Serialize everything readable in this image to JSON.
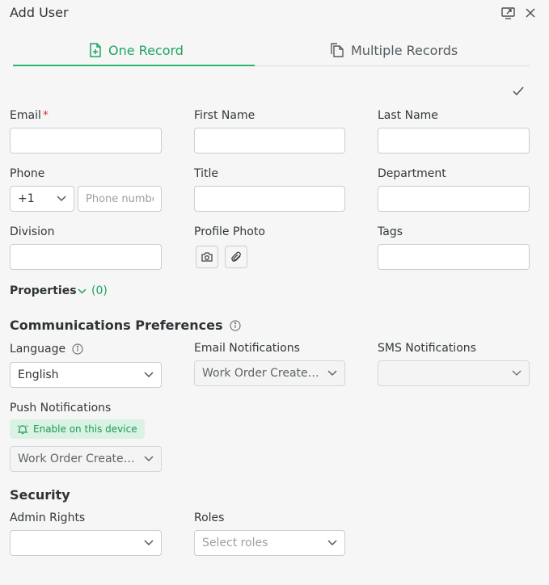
{
  "window": {
    "title": "Add User"
  },
  "tabs": [
    {
      "label": "One Record"
    },
    {
      "label": "Multiple Records"
    }
  ],
  "fields": {
    "email": {
      "label": "Email",
      "required_mark": "*",
      "value": ""
    },
    "first_name": {
      "label": "First Name",
      "value": ""
    },
    "last_name": {
      "label": "Last Name",
      "value": ""
    },
    "phone": {
      "label": "Phone",
      "country_code": "+1",
      "placeholder": "Phone number",
      "value": ""
    },
    "title": {
      "label": "Title",
      "value": ""
    },
    "department": {
      "label": "Department",
      "value": ""
    },
    "division": {
      "label": "Division",
      "value": ""
    },
    "profile_photo": {
      "label": "Profile Photo"
    },
    "tags": {
      "label": "Tags",
      "value": ""
    }
  },
  "properties": {
    "label": "Properties",
    "count": "(0)"
  },
  "communications": {
    "title": "Communications Preferences",
    "language": {
      "label": "Language",
      "value": "English"
    },
    "email_notifications": {
      "label": "Email Notifications",
      "value": "Work Order Created, Work Order Updated"
    },
    "sms_notifications": {
      "label": "SMS Notifications",
      "value": ""
    },
    "push_notifications": {
      "label": "Push Notifications",
      "enable_label": "Enable on this device",
      "value": "Work Order Created, Work Order Updated"
    }
  },
  "security": {
    "title": "Security",
    "admin_rights": {
      "label": "Admin Rights",
      "value": ""
    },
    "roles": {
      "label": "Roles",
      "placeholder": "Select roles"
    }
  },
  "colors": {
    "accent": "#1fa463",
    "required": "#e0343c",
    "badge_bg": "#d9f2e3"
  }
}
